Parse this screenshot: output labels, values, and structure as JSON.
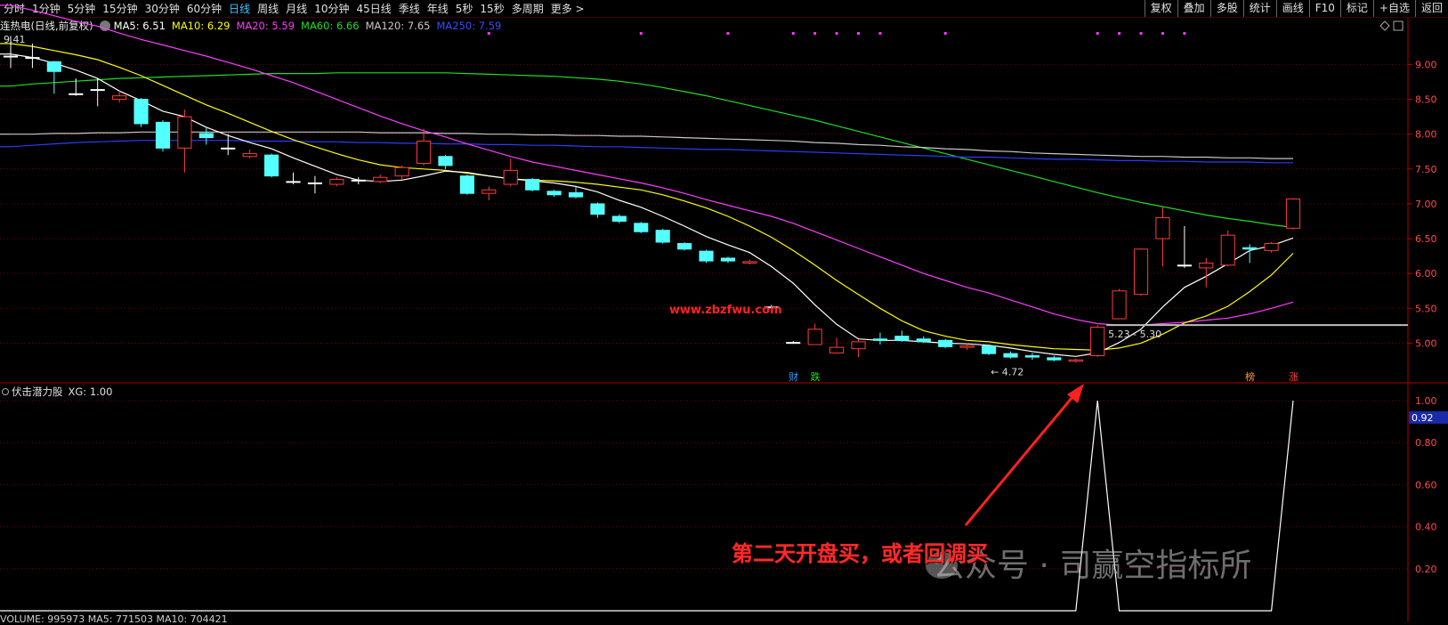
{
  "toolbar": {
    "periods": [
      "分时",
      "1分钟",
      "5分钟",
      "15分钟",
      "30分钟",
      "60分钟",
      "日线",
      "周线",
      "月线",
      "10分钟",
      "45日线",
      "季线",
      "年线",
      "5秒",
      "15秒",
      "多周期",
      "更多 >"
    ],
    "active_period": "日线",
    "right_items": [
      "复权",
      "叠加",
      "多股",
      "统计",
      "画线",
      "F10",
      "标记",
      "+自选",
      "返回"
    ]
  },
  "main_info": {
    "title": "连热电(日线,前复权)",
    "ma5": "MA5: 6.51",
    "ma10": "MA10: 6.29",
    "ma20": "MA20: 5.59",
    "ma60": "MA60: 6.66",
    "ma120": "MA120: 7.65",
    "ma250": "MA250: 7.59"
  },
  "colors": {
    "up": "#ff3b3b",
    "down": "#54ffff",
    "ma5": "#ffffff",
    "ma10": "#ffff00",
    "ma20": "#ff3cff",
    "ma60": "#22dd22",
    "ma120": "#c8c8c8",
    "ma250": "#2a3cff",
    "grid": "#7a0000",
    "axis_text": "#ff4a4a"
  },
  "price_axis": [
    "9.00",
    "8.50",
    "8.00",
    "7.50",
    "7.00",
    "6.50",
    "6.00",
    "5.50",
    "5.00"
  ],
  "price_range": [
    4.52,
    9.44
  ],
  "labels": {
    "high": "9.41",
    "low": "4.72",
    "range": "5.23 - 5.30",
    "site": "www.zbzfwu.com",
    "tag_cai": "财",
    "tag_die": "跌",
    "tag_bang": "榜",
    "tag_zhang": "涨"
  },
  "candles": [
    {
      "o": 9.12,
      "c": 9.12,
      "h": 9.41,
      "l": 8.95
    },
    {
      "o": 9.1,
      "c": 9.1,
      "h": 9.3,
      "l": 8.95
    },
    {
      "o": 9.04,
      "c": 8.9,
      "h": 9.05,
      "l": 8.58
    },
    {
      "o": 8.58,
      "c": 8.58,
      "h": 8.8,
      "l": 8.55
    },
    {
      "o": 8.64,
      "c": 8.64,
      "h": 8.8,
      "l": 8.4
    },
    {
      "o": 8.5,
      "c": 8.55,
      "h": 8.62,
      "l": 8.45
    },
    {
      "o": 8.5,
      "c": 8.15,
      "h": 8.52,
      "l": 8.1
    },
    {
      "o": 8.17,
      "c": 7.8,
      "h": 8.2,
      "l": 7.75
    },
    {
      "o": 7.8,
      "c": 8.25,
      "h": 8.35,
      "l": 7.45
    },
    {
      "o": 8.01,
      "c": 7.95,
      "h": 8.1,
      "l": 7.85
    },
    {
      "o": 7.8,
      "c": 7.8,
      "h": 8.0,
      "l": 7.7
    },
    {
      "o": 7.68,
      "c": 7.72,
      "h": 7.78,
      "l": 7.65
    },
    {
      "o": 7.7,
      "c": 7.4,
      "h": 7.72,
      "l": 7.38
    },
    {
      "o": 7.32,
      "c": 7.32,
      "h": 7.45,
      "l": 7.28
    },
    {
      "o": 7.3,
      "c": 7.3,
      "h": 7.4,
      "l": 7.15
    },
    {
      "o": 7.28,
      "c": 7.35,
      "h": 7.38,
      "l": 7.25
    },
    {
      "o": 7.34,
      "c": 7.34,
      "h": 7.38,
      "l": 7.28
    },
    {
      "o": 7.32,
      "c": 7.38,
      "h": 7.42,
      "l": 7.3
    },
    {
      "o": 7.4,
      "c": 7.52,
      "h": 7.55,
      "l": 7.35
    },
    {
      "o": 7.58,
      "c": 7.9,
      "h": 8.08,
      "l": 7.55
    },
    {
      "o": 7.68,
      "c": 7.55,
      "h": 7.7,
      "l": 7.5
    },
    {
      "o": 7.4,
      "c": 7.15,
      "h": 7.42,
      "l": 7.13
    },
    {
      "o": 7.15,
      "c": 7.2,
      "h": 7.25,
      "l": 7.05
    },
    {
      "o": 7.28,
      "c": 7.48,
      "h": 7.65,
      "l": 7.25
    },
    {
      "o": 7.35,
      "c": 7.2,
      "h": 7.37,
      "l": 7.18
    },
    {
      "o": 7.18,
      "c": 7.13,
      "h": 7.2,
      "l": 7.1
    },
    {
      "o": 7.16,
      "c": 7.1,
      "h": 7.25,
      "l": 7.08
    },
    {
      "o": 7.0,
      "c": 6.85,
      "h": 7.02,
      "l": 6.8
    },
    {
      "o": 6.82,
      "c": 6.75,
      "h": 6.85,
      "l": 6.72
    },
    {
      "o": 6.72,
      "c": 6.6,
      "h": 6.74,
      "l": 6.58
    },
    {
      "o": 6.62,
      "c": 6.45,
      "h": 6.64,
      "l": 6.43
    },
    {
      "o": 6.43,
      "c": 6.35,
      "h": 6.45,
      "l": 6.33
    },
    {
      "o": 6.32,
      "c": 6.18,
      "h": 6.34,
      "l": 6.15
    },
    {
      "o": 6.22,
      "c": 6.18,
      "h": 6.24,
      "l": 6.15
    },
    {
      "o": 6.15,
      "c": 6.17,
      "h": 6.2,
      "l": 6.13
    },
    {
      "o": 5.52,
      "c": 5.52,
      "h": 5.55,
      "l": 5.5
    },
    {
      "o": 5.01,
      "c": 5.01,
      "h": 5.03,
      "l": 4.99
    },
    {
      "o": 4.98,
      "c": 5.2,
      "h": 5.28,
      "l": 4.98
    },
    {
      "o": 4.86,
      "c": 4.94,
      "h": 5.08,
      "l": 4.85
    },
    {
      "o": 4.92,
      "c": 5.02,
      "h": 5.05,
      "l": 4.8
    },
    {
      "o": 5.06,
      "c": 5.04,
      "h": 5.15,
      "l": 4.98
    },
    {
      "o": 5.1,
      "c": 5.04,
      "h": 5.18,
      "l": 5.02
    },
    {
      "o": 5.06,
      "c": 5.02,
      "h": 5.1,
      "l": 5.0
    },
    {
      "o": 5.04,
      "c": 4.95,
      "h": 5.06,
      "l": 4.93
    },
    {
      "o": 4.94,
      "c": 4.96,
      "h": 4.99,
      "l": 4.9
    },
    {
      "o": 4.96,
      "c": 4.85,
      "h": 4.98,
      "l": 4.83
    },
    {
      "o": 4.85,
      "c": 4.8,
      "h": 4.88,
      "l": 4.78
    },
    {
      "o": 4.82,
      "c": 4.8,
      "h": 4.86,
      "l": 4.76
    },
    {
      "o": 4.79,
      "c": 4.76,
      "h": 4.82,
      "l": 4.74
    },
    {
      "o": 4.74,
      "c": 4.76,
      "h": 4.78,
      "l": 4.72
    },
    {
      "o": 4.82,
      "c": 5.23,
      "h": 5.26,
      "l": 4.8
    },
    {
      "o": 5.35,
      "c": 5.75,
      "h": 5.78,
      "l": 5.35
    },
    {
      "o": 5.7,
      "c": 6.35,
      "h": 6.36,
      "l": 5.68
    },
    {
      "o": 6.5,
      "c": 6.8,
      "h": 6.95,
      "l": 6.1
    },
    {
      "o": 6.12,
      "c": 6.12,
      "h": 6.68,
      "l": 6.08
    },
    {
      "o": 6.08,
      "c": 6.15,
      "h": 6.22,
      "l": 5.8
    },
    {
      "o": 6.12,
      "c": 6.55,
      "h": 6.62,
      "l": 6.1
    },
    {
      "o": 6.37,
      "c": 6.35,
      "h": 6.42,
      "l": 6.15
    },
    {
      "o": 6.33,
      "c": 6.43,
      "h": 6.45,
      "l": 6.3
    },
    {
      "o": 6.65,
      "c": 7.07,
      "h": 7.08,
      "l": 6.63
    }
  ],
  "ma_lines": {
    "ma5": [
      9.15,
      9.1,
      9.02,
      8.92,
      8.8,
      8.62,
      8.48,
      8.33,
      8.25,
      8.1,
      7.98,
      7.88,
      7.79,
      7.66,
      7.54,
      7.42,
      7.34,
      7.32,
      7.34,
      7.4,
      7.47,
      7.45,
      7.4,
      7.36,
      7.33,
      7.3,
      7.25,
      7.17,
      7.05,
      6.95,
      6.82,
      6.68,
      6.53,
      6.41,
      6.3,
      6.1,
      5.86,
      5.55,
      5.27,
      5.06,
      5.04,
      5.04,
      5.02,
      5.0,
      4.99,
      4.97,
      4.93,
      4.88,
      4.84,
      4.81,
      4.86,
      5.01,
      5.2,
      5.52,
      5.8,
      5.96,
      6.14,
      6.33,
      6.4,
      6.51
    ],
    "ma10": [
      9.3,
      9.26,
      9.2,
      9.14,
      9.07,
      8.96,
      8.84,
      8.7,
      8.56,
      8.42,
      8.3,
      8.17,
      8.04,
      7.92,
      7.82,
      7.72,
      7.63,
      7.56,
      7.52,
      7.5,
      7.48,
      7.44,
      7.4,
      7.36,
      7.34,
      7.33,
      7.31,
      7.28,
      7.24,
      7.2,
      7.13,
      7.04,
      6.94,
      6.82,
      6.68,
      6.52,
      6.33,
      6.12,
      5.9,
      5.7,
      5.5,
      5.32,
      5.18,
      5.1,
      5.04,
      5.02,
      4.98,
      4.95,
      4.92,
      4.91,
      4.9,
      4.93,
      5.0,
      5.13,
      5.29,
      5.39,
      5.53,
      5.74,
      5.98,
      6.29
    ],
    "ma20": [
      9.85,
      9.78,
      9.7,
      9.62,
      9.55,
      9.45,
      9.36,
      9.28,
      9.2,
      9.12,
      9.03,
      8.94,
      8.84,
      8.74,
      8.62,
      8.5,
      8.38,
      8.26,
      8.15,
      8.05,
      7.96,
      7.86,
      7.77,
      7.68,
      7.6,
      7.54,
      7.48,
      7.42,
      7.36,
      7.3,
      7.23,
      7.15,
      7.06,
      6.98,
      6.9,
      6.82,
      6.72,
      6.6,
      6.48,
      6.36,
      6.24,
      6.12,
      6.0,
      5.9,
      5.8,
      5.72,
      5.62,
      5.52,
      5.42,
      5.34,
      5.28,
      5.26,
      5.26,
      5.28,
      5.3,
      5.33,
      5.36,
      5.42,
      5.5,
      5.59
    ],
    "ma60": [
      8.69,
      8.72,
      8.74,
      8.76,
      8.78,
      8.8,
      8.81,
      8.82,
      8.83,
      8.84,
      8.85,
      8.86,
      8.87,
      8.87,
      8.87,
      8.88,
      8.88,
      8.88,
      8.88,
      8.88,
      8.88,
      8.87,
      8.86,
      8.85,
      8.84,
      8.83,
      8.81,
      8.79,
      8.76,
      8.72,
      8.67,
      8.61,
      8.55,
      8.48,
      8.41,
      8.34,
      8.27,
      8.2,
      8.12,
      8.04,
      7.96,
      7.88,
      7.8,
      7.72,
      7.64,
      7.56,
      7.48,
      7.4,
      7.32,
      7.24,
      7.16,
      7.09,
      7.02,
      6.96,
      6.9,
      6.84,
      6.79,
      6.75,
      6.7,
      6.66
    ],
    "ma120": [
      8.0,
      8.0,
      8.01,
      8.01,
      8.02,
      8.02,
      8.03,
      8.03,
      8.03,
      8.03,
      8.03,
      8.03,
      8.03,
      8.03,
      8.03,
      8.03,
      8.03,
      8.02,
      8.02,
      8.02,
      8.01,
      8.01,
      8.0,
      8.0,
      7.99,
      7.99,
      7.98,
      7.98,
      7.97,
      7.97,
      7.96,
      7.95,
      7.94,
      7.93,
      7.92,
      7.91,
      7.9,
      7.88,
      7.87,
      7.85,
      7.84,
      7.82,
      7.81,
      7.79,
      7.78,
      7.76,
      7.75,
      7.73,
      7.72,
      7.71,
      7.7,
      7.69,
      7.68,
      7.68,
      7.67,
      7.67,
      7.66,
      7.66,
      7.65,
      7.65
    ],
    "ma250": [
      7.82,
      7.84,
      7.86,
      7.88,
      7.89,
      7.9,
      7.91,
      7.91,
      7.91,
      7.91,
      7.91,
      7.9,
      7.9,
      7.9,
      7.89,
      7.89,
      7.88,
      7.88,
      7.87,
      7.87,
      7.86,
      7.86,
      7.85,
      7.85,
      7.84,
      7.84,
      7.83,
      7.82,
      7.82,
      7.81,
      7.8,
      7.79,
      7.78,
      7.78,
      7.77,
      7.76,
      7.75,
      7.74,
      7.73,
      7.72,
      7.71,
      7.7,
      7.69,
      7.68,
      7.67,
      7.67,
      7.66,
      7.65,
      7.64,
      7.64,
      7.63,
      7.62,
      7.62,
      7.61,
      7.61,
      7.6,
      7.6,
      7.6,
      7.59,
      7.59
    ]
  },
  "markers_top": [
    22,
    29,
    33,
    36,
    37,
    38,
    39,
    40,
    43,
    50,
    51,
    52,
    53,
    54
  ],
  "support_level": 5.26,
  "sub_indicator": {
    "title": "伏击潜力股",
    "value_label": "XG: 1.00",
    "axis": [
      "1.00",
      "0.80",
      "0.60",
      "0.40",
      "0.20"
    ],
    "current": "0.92",
    "signal_indices": [
      50,
      59
    ],
    "values": [
      0,
      0,
      0,
      0,
      0,
      0,
      0,
      0,
      0,
      0,
      0,
      0,
      0,
      0,
      0,
      0,
      0,
      0,
      0,
      0,
      0,
      0,
      0,
      0,
      0,
      0,
      0,
      0,
      0,
      0,
      0,
      0,
      0,
      0,
      0,
      0,
      0,
      0,
      0,
      0,
      0,
      0,
      0,
      0,
      0,
      0,
      0,
      0,
      0,
      0,
      1,
      0,
      0,
      0,
      0,
      0,
      0,
      0,
      0,
      1
    ]
  },
  "annotation": "第二天开盘买，或者回调买",
  "watermark": "公众号 · 司赢空指标所",
  "volume_info": "VOLUME: 995973  MA5: 771503  MA10: 704421"
}
